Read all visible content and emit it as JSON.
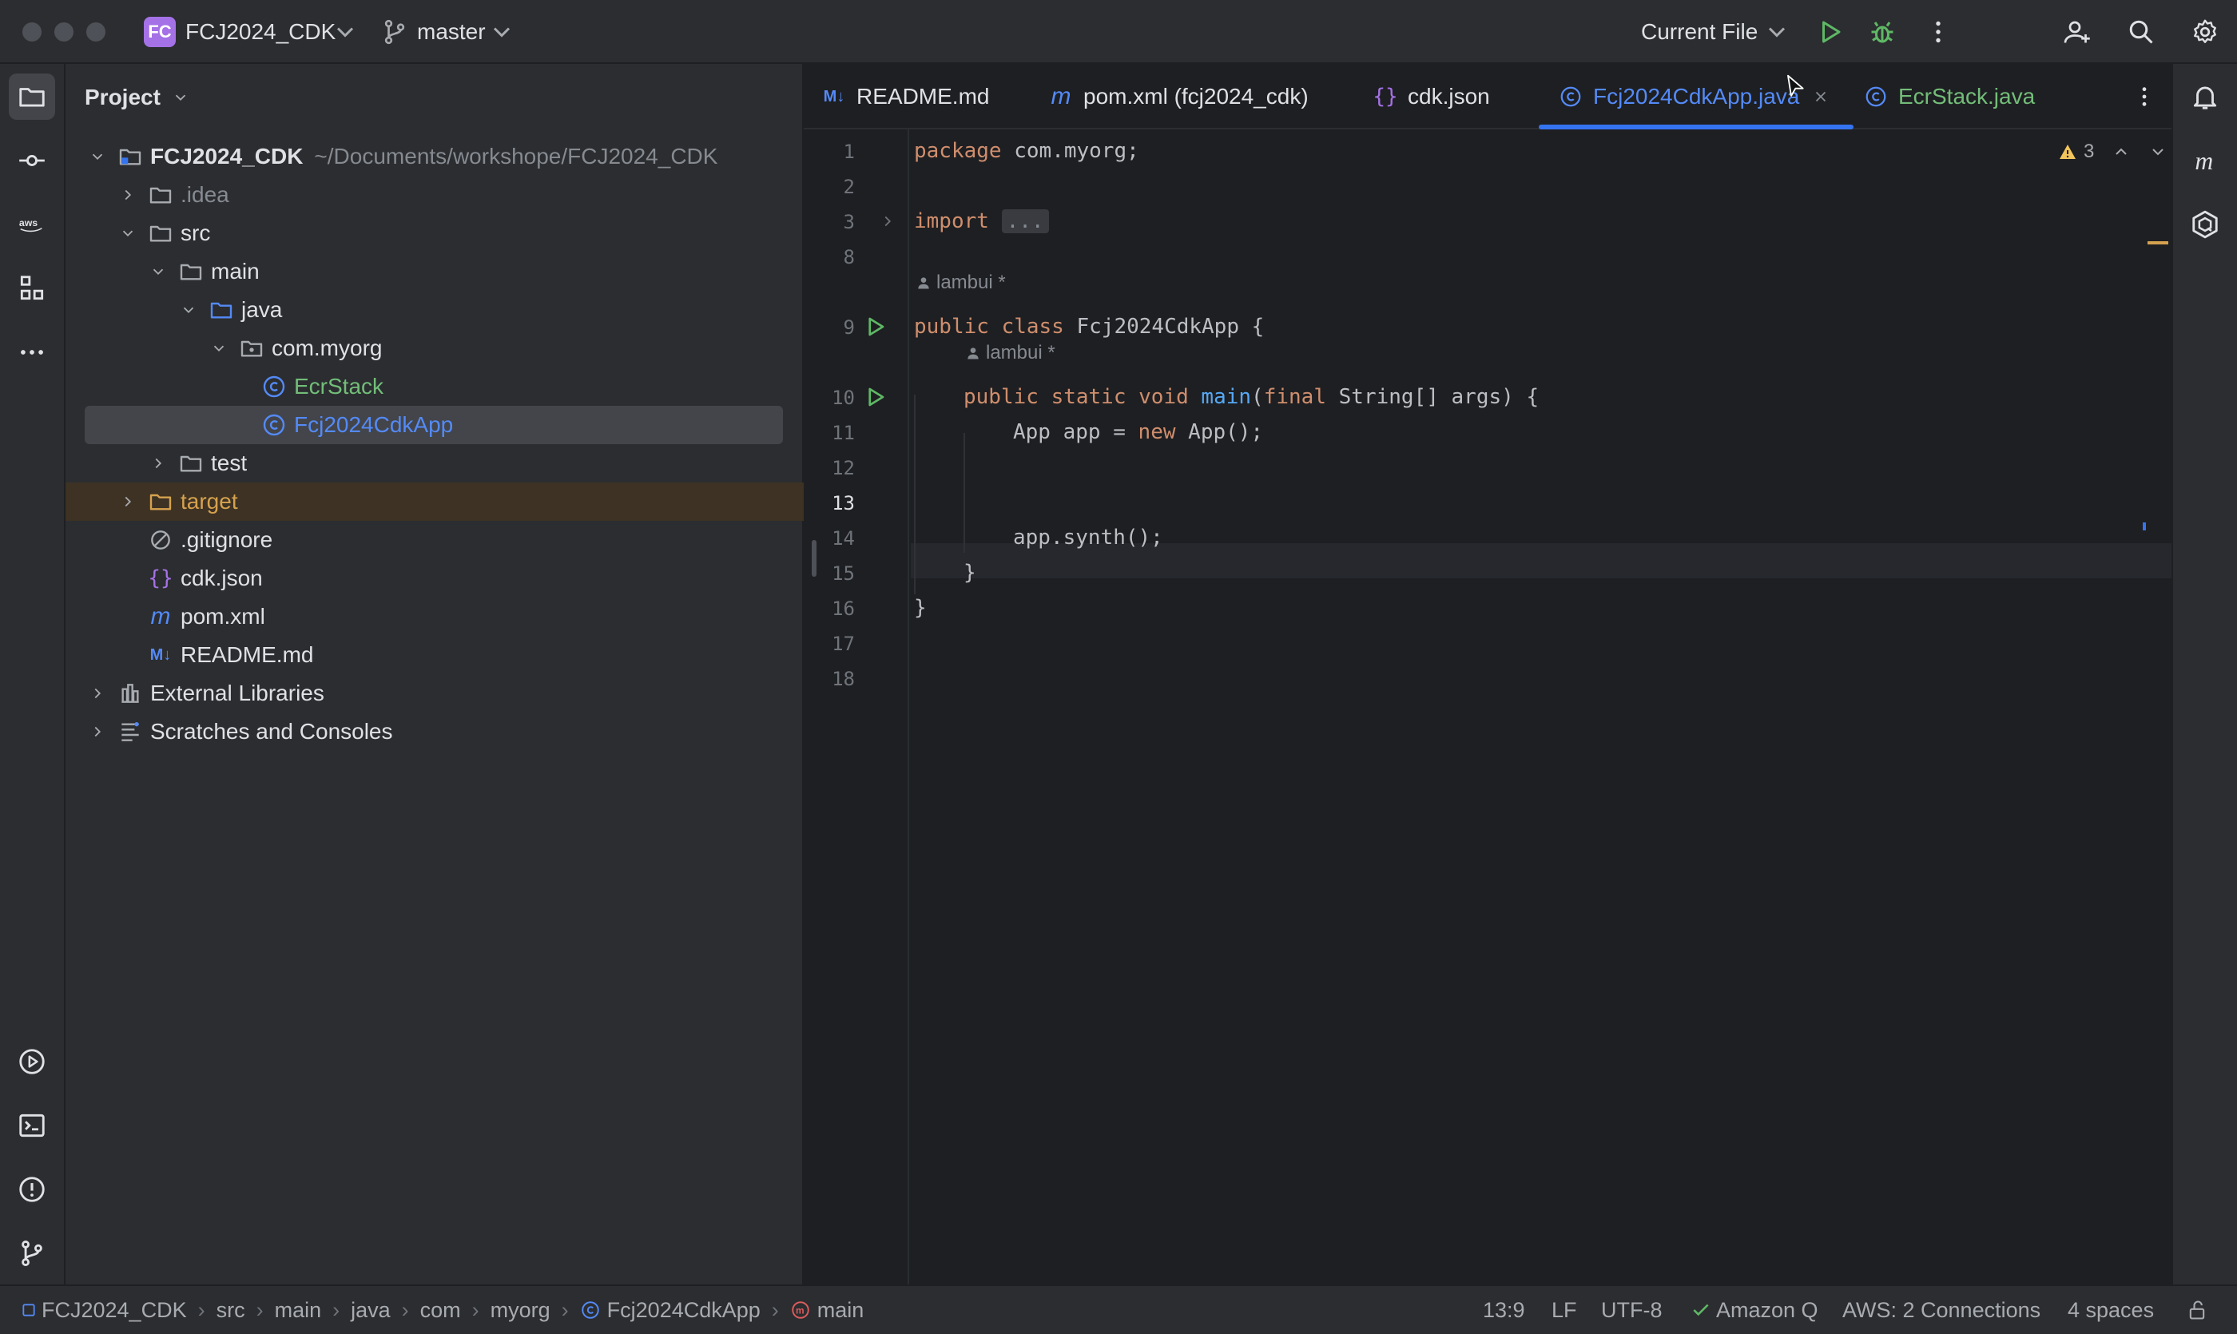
{
  "titlebar": {
    "project_badge": "FC",
    "project_name": "FCJ2024_CDK",
    "branch": "master",
    "run_config": "Current File"
  },
  "project_panel": {
    "title": "Project",
    "tree": [
      {
        "label": "FCJ2024_CDK",
        "path": "~/Documents/workshope/FCJ2024_CDK"
      },
      {
        "label": ".idea"
      },
      {
        "label": "src"
      },
      {
        "label": "main"
      },
      {
        "label": "java"
      },
      {
        "label": "com.myorg"
      },
      {
        "label": "EcrStack"
      },
      {
        "label": "Fcj2024CdkApp"
      },
      {
        "label": "test"
      },
      {
        "label": "target"
      },
      {
        "label": ".gitignore"
      },
      {
        "label": "cdk.json"
      },
      {
        "label": "pom.xml"
      },
      {
        "label": "README.md"
      },
      {
        "label": "External Libraries"
      },
      {
        "label": "Scratches and Consoles"
      }
    ]
  },
  "editor": {
    "tabs": [
      {
        "label": "README.md",
        "icon": "M↓"
      },
      {
        "label": "pom.xml (fcj2024_cdk)",
        "icon": "m"
      },
      {
        "label": "cdk.json",
        "icon": "{}"
      },
      {
        "label": "Fcj2024CdkApp.java",
        "icon": "©"
      },
      {
        "label": "EcrStack.java",
        "icon": "©"
      }
    ],
    "warnings_count": "3",
    "author": "lambui *",
    "line_numbers": [
      "1",
      "2",
      "3",
      "8",
      "9",
      "10",
      "11",
      "12",
      "13",
      "14",
      "15",
      "16",
      "17",
      "18"
    ],
    "lines": {
      "l1_kw": "package",
      "l1_rest": " com.myorg;",
      "l3_kw": "import",
      "l3_fold": "...",
      "l9_kw": "public class",
      "l9_rest": " Fcj2024CdkApp {",
      "l10_kw1": "public static void",
      "l10_fn": "main",
      "l10_p1": "(",
      "l10_kw2": "final",
      "l10_rest": " String[] args) {",
      "l11_a": "App app = ",
      "l11_kw": "new",
      "l11_b": " App();",
      "l14": "app.synth();",
      "l15": "}",
      "l16": "}"
    }
  },
  "statusbar": {
    "crumbs": [
      "FCJ2024_CDK",
      "src",
      "main",
      "java",
      "com",
      "myorg",
      "Fcj2024CdkApp",
      "main"
    ],
    "position": "13:9",
    "line_sep": "LF",
    "encoding": "UTF-8",
    "amazon_q": "Amazon Q",
    "aws": "AWS: 2 Connections",
    "indent": "4 spaces"
  },
  "colors": {
    "accent": "#3574f0",
    "class_icon": "#548af7",
    "vcs_added": "#73bd79",
    "excluded": "#d6a24f"
  }
}
